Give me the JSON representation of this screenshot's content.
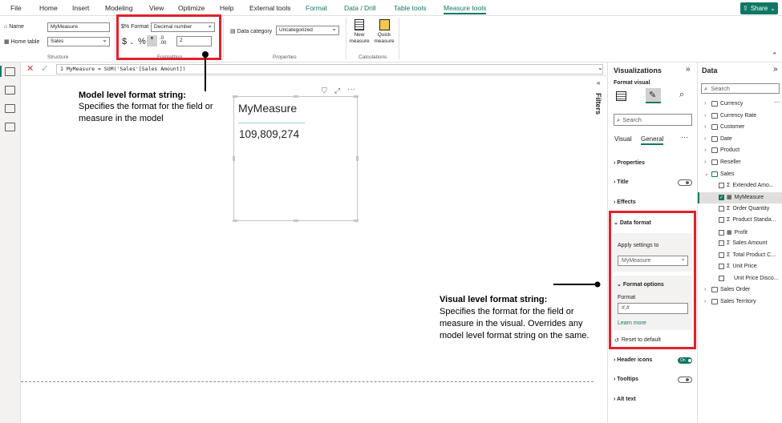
{
  "menu": {
    "items": [
      "File",
      "Home",
      "Insert",
      "Modeling",
      "View",
      "Optimize",
      "Help",
      "External tools",
      "Format",
      "Data / Drill",
      "Table tools",
      "Measure tools"
    ],
    "share": "Share"
  },
  "ribbon": {
    "name_label": "Name",
    "name_value": "MyMeasure",
    "home_table_label": "Home table",
    "home_table_value": "Sales",
    "structure_group": "Structure",
    "format_label": "Format",
    "format_value": "Decimal number",
    "decimals_value": "2",
    "formatting_group": "Formatting",
    "data_category_label": "Data category",
    "data_category_value": "Uncategorized",
    "properties_group": "Properties",
    "new_measure_label": "New measure",
    "quick_measure_label": "Quick measure",
    "calculations_group": "Calculations"
  },
  "formula": {
    "text": "1  MyMeasure = SUM('Sales'[Sales Amount])"
  },
  "card": {
    "title": "MyMeasure",
    "value": "109,809,274"
  },
  "annotations": {
    "model_title": "Model level format string:",
    "model_text": "Specifies the format for the field or measure in the model",
    "visual_title": "Visual level format string:",
    "visual_text": "Specifies the format for the field or measure in the visual. Overrides any model level format string on the same."
  },
  "filters": {
    "label": "Filters"
  },
  "viz": {
    "title": "Visualizations",
    "subtitle": "Format visual",
    "search_placeholder": "Search",
    "tabs": [
      "Visual",
      "General"
    ],
    "sections": [
      "Properties",
      "Title",
      "Effects",
      "Data format"
    ],
    "apply_label": "Apply settings to",
    "apply_value": "MyMeasure",
    "format_options": "Format options",
    "format_label": "Format",
    "format_value": "#,#",
    "learn_more": "Learn more",
    "reset": "Reset to default",
    "bottom_sections": [
      "Header icons",
      "Tooltips",
      "Alt text"
    ],
    "header_icons_state": "On"
  },
  "data": {
    "title": "Data",
    "search_placeholder": "Search",
    "tables": [
      "Currency",
      "Currency Rate",
      "Customer",
      "Date",
      "Product",
      "Reseller",
      "Sales"
    ],
    "sales_fields": [
      "Extended Amo...",
      "MyMeasure",
      "Order Quantity",
      "Product Standa...",
      "Profit",
      "Sales Amount",
      "Total Product C...",
      "Unit Price",
      "Unit Price Disco..."
    ],
    "tables_after": [
      "Sales Order",
      "Sales Territory"
    ]
  },
  "colors": {
    "accent": "#117865",
    "highlight": "#e3202c"
  }
}
